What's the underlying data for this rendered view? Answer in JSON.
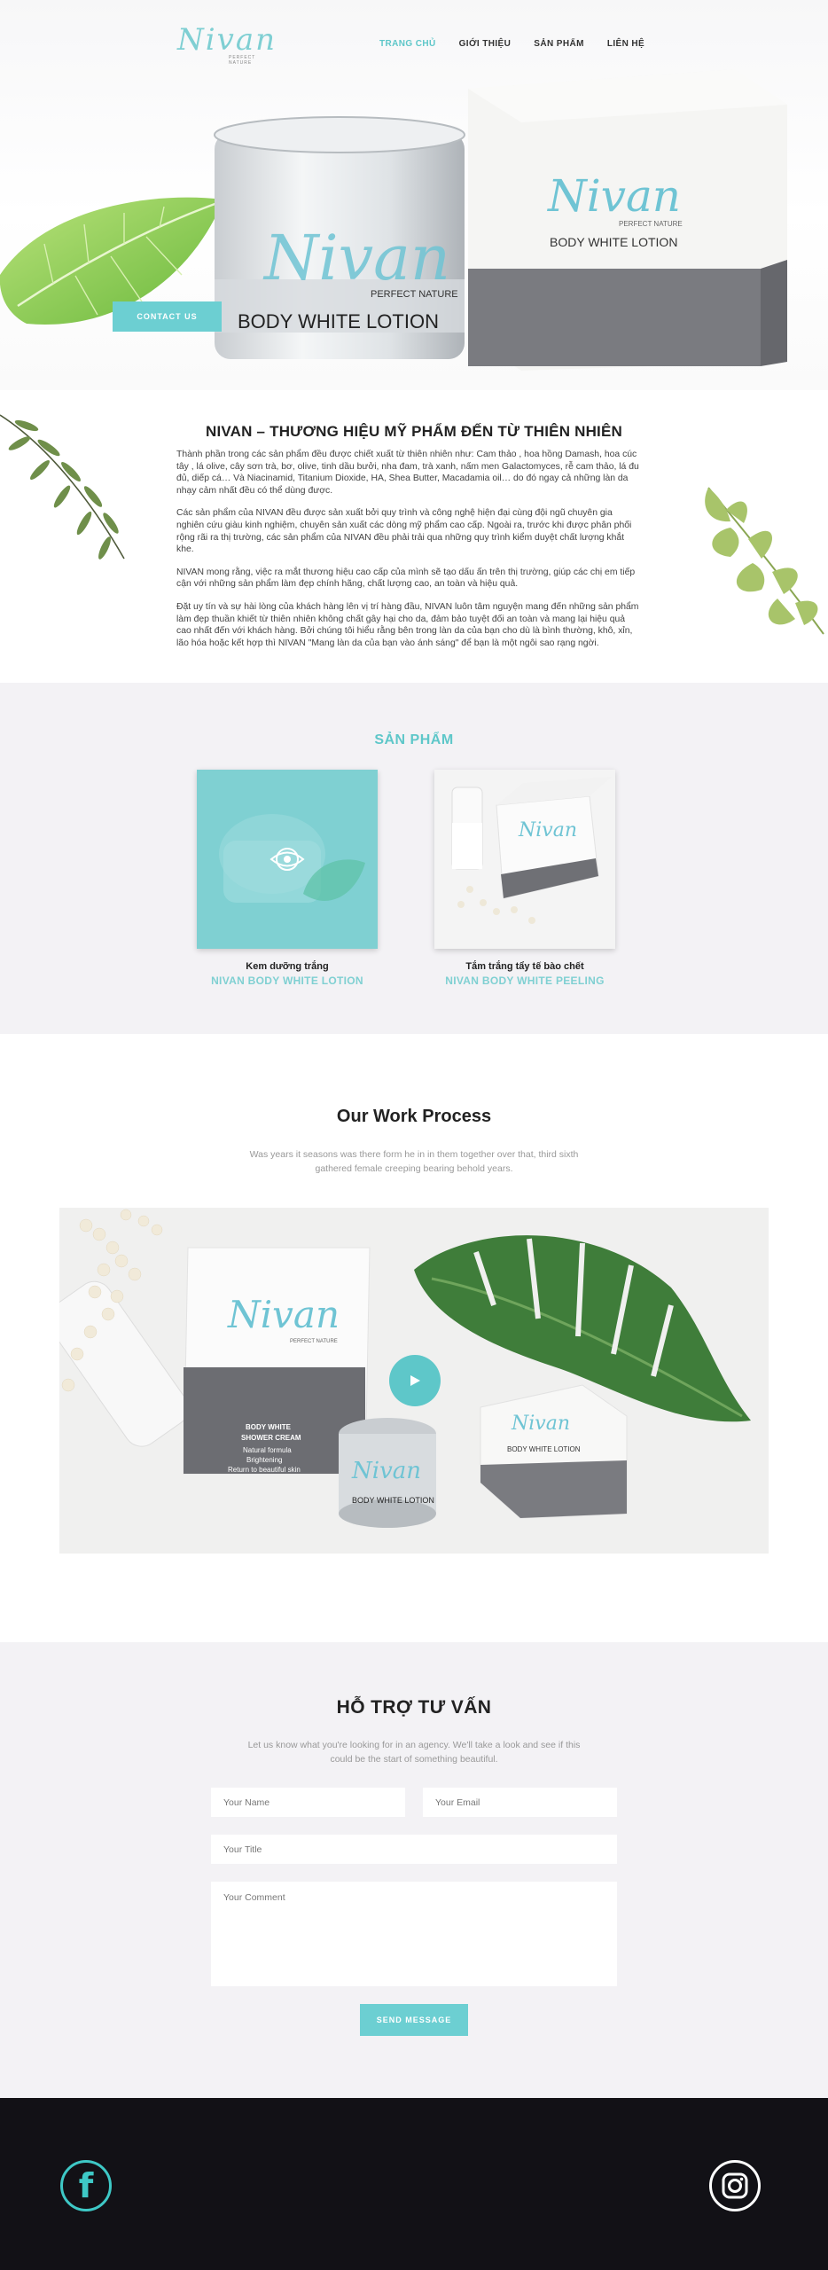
{
  "header": {
    "logo_text": "Nivan",
    "logo_tagline": "PERFECT NATURE",
    "nav": [
      {
        "label": "TRANG CHỦ",
        "active": true
      },
      {
        "label": "GIỚI THIỆU",
        "active": false
      },
      {
        "label": "SẢN PHẨM",
        "active": false
      },
      {
        "label": "LIÊN HỆ",
        "active": false
      }
    ]
  },
  "hero": {
    "contact_button": "CONTACT US",
    "jar_label": "BODY WHITE LOTION",
    "box_label": "BODY WHITE LOTION"
  },
  "about": {
    "title": "NIVAN – THƯƠNG HIỆU MỸ PHẨM ĐẾN TỪ THIÊN NHIÊN",
    "paragraphs": [
      "Thành phần trong các sản phẩm đều được chiết xuất từ thiên nhiên như: Cam thảo , hoa hồng Damash, hoa cúc tây , lá olive, cây sơn trà, bơ, olive, tinh dầu bưởi, nha đam, trà xanh, nấm men Galactomyces, rễ cam thảo, lá đu đủ, diếp cá… Và Niacinamid, Titanium Dioxide, HA, Shea Butter, Macadamia oil… do đó ngay cả những làn da nhạy cảm nhất đều có thể dùng được.",
      "Các sản phẩm của NIVAN đều được sản xuất bởi quy trình và công nghệ hiện đại cùng đội ngũ chuyên gia nghiên cứu giàu kinh nghiệm, chuyên sản xuất các dòng mỹ phẩm cao cấp. Ngoài ra, trước khi được phân phối rộng rãi ra thị trường, các sản phẩm của NIVAN đều phải trải qua những quy trình kiểm duyệt chất lượng khắt khe.",
      "NIVAN mong rằng, việc ra mắt thương hiệu cao cấp của mình sẽ tạo dấu ấn trên thị trường, giúp các chị em tiếp cận với những sản phẩm làm đẹp chính hãng, chất lượng cao, an toàn và hiệu quả.",
      "Đặt uy tín và sự hài lòng của khách hàng lên vị trí hàng đầu, NIVAN luôn tâm nguyện mang đến những sản phẩm làm đẹp thuần khiết từ thiên nhiên không chất gây hại cho da, đảm bảo tuyệt đối an toàn và mang lại hiệu quả cao nhất đến với khách hàng. Bởi chúng tôi hiểu rằng bên trong làn da của bạn cho dù là bình thường, khô, xỉn, lão hóa hoặc kết hợp thì NIVAN \"Mang làn da của bạn vào ánh sáng\" để bạn là một ngôi sao rạng ngời."
    ]
  },
  "products": {
    "title": "SẢN PHẨM",
    "items": [
      {
        "name": "Kem dưỡng trắng",
        "sub": "NIVAN BODY WHITE LOTION"
      },
      {
        "name": "Tắm trắng tẩy tế bào chết",
        "sub": "NIVAN BODY WHITE PEELING"
      }
    ]
  },
  "work": {
    "title": "Our Work Process",
    "subtitle": "Was years it seasons was there form he in in them together over that, third sixth gathered female creeping bearing behold years.",
    "shower_box_lines": [
      "BODY WHITE",
      "SHOWER CREAM",
      "Natural formula",
      "Brightening",
      "Return to beautiful skin"
    ],
    "jar_label": "BODY WHITE LOTION",
    "small_box_label": "BODY WHITE LOTION"
  },
  "support": {
    "title": "HỖ TRỢ TƯ VẤN",
    "subtitle": "Let us know what you're looking for in an agency. We'll take a look and see if this could be the start of something beautiful.",
    "name_placeholder": "Your Name",
    "email_placeholder": "Your Email",
    "title_placeholder": "Your Title",
    "comment_placeholder": "Your Comment",
    "send_button": "SEND MESSAGE"
  },
  "footer": {
    "facebook_icon": "facebook-icon",
    "instagram_icon": "instagram-icon"
  }
}
